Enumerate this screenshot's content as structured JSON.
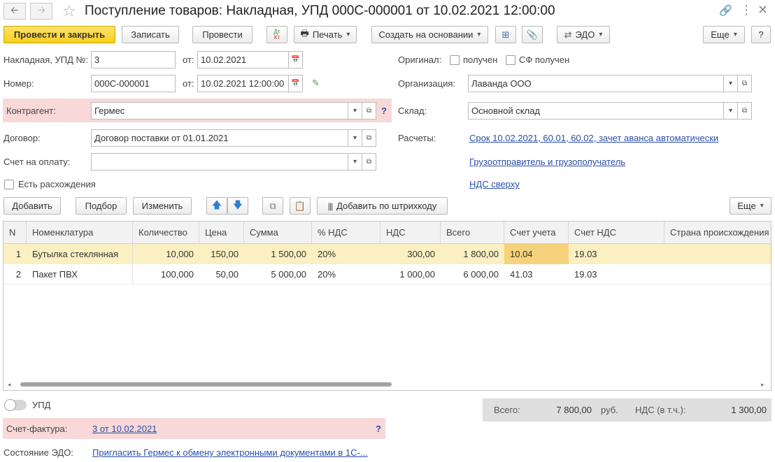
{
  "title": "Поступление товаров: Накладная, УПД 000С-000001 от 10.02.2021 12:00:00",
  "toolbar": {
    "post_close": "Провести и закрыть",
    "save": "Записать",
    "post": "Провести",
    "dtkt": "Дт Кт",
    "print": "Печать",
    "create_based": "Создать на основании",
    "edo": "ЭДО",
    "more": "Еще",
    "help": "?"
  },
  "form": {
    "invoice_label": "Накладная, УПД №:",
    "invoice_no": "3",
    "from_label": "от:",
    "invoice_date": "10.02.2021",
    "number_label": "Номер:",
    "number": "000С-000001",
    "number_date": "10.02.2021 12:00:00",
    "original_label": "Оригинал:",
    "received": "получен",
    "sf_received": "СФ получен",
    "org_label": "Организация:",
    "org": "Лаванда ООО",
    "counterparty_label": "Контрагент:",
    "counterparty": "Гермес",
    "q": "?",
    "warehouse_label": "Склад:",
    "warehouse": "Основной склад",
    "contract_label": "Договор:",
    "contract": "Договор поставки от 01.01.2021",
    "settlements_label": "Расчеты:",
    "settlements_link": "Срок 10.02.2021, 60.01, 60.02, зачет аванса автоматически",
    "pay_invoice_label": "Счет на оплату:",
    "pay_invoice": "",
    "shipper_link": "Грузоотправитель и грузополучатель",
    "discrepancy": "Есть расхождения",
    "vat_link": "НДС сверху"
  },
  "table_toolbar": {
    "add": "Добавить",
    "pick": "Подбор",
    "change": "Изменить",
    "barcode": "Добавить по штрихкоду",
    "more": "Еще"
  },
  "table": {
    "headers": [
      "N",
      "Номенклатура",
      "Количество",
      "Цена",
      "Сумма",
      "% НДС",
      "НДС",
      "Всего",
      "Счет учета",
      "Счет НДС",
      "Страна происхождения"
    ],
    "rows": [
      [
        "1",
        "Бутылка стеклянная",
        "10,000",
        "150,00",
        "1 500,00",
        "20%",
        "300,00",
        "1 800,00",
        "10.04",
        "19.03",
        ""
      ],
      [
        "2",
        "Пакет ПВХ",
        "100,000",
        "50,00",
        "5 000,00",
        "20%",
        "1 000,00",
        "6 000,00",
        "41.03",
        "19.03",
        ""
      ]
    ]
  },
  "footer": {
    "upd_label": "УПД",
    "total_label": "Всего:",
    "total": "7 800,00",
    "currency": "руб.",
    "vat_label": "НДС (в т.ч.):",
    "vat": "1 300,00",
    "sf_label": "Счет-фактура:",
    "sf_link": "3 от 10.02.2021",
    "q": "?",
    "edo_label": "Состояние ЭДО:",
    "edo_link": "Пригласить Гермес к обмену электронными документами в 1С-..."
  }
}
